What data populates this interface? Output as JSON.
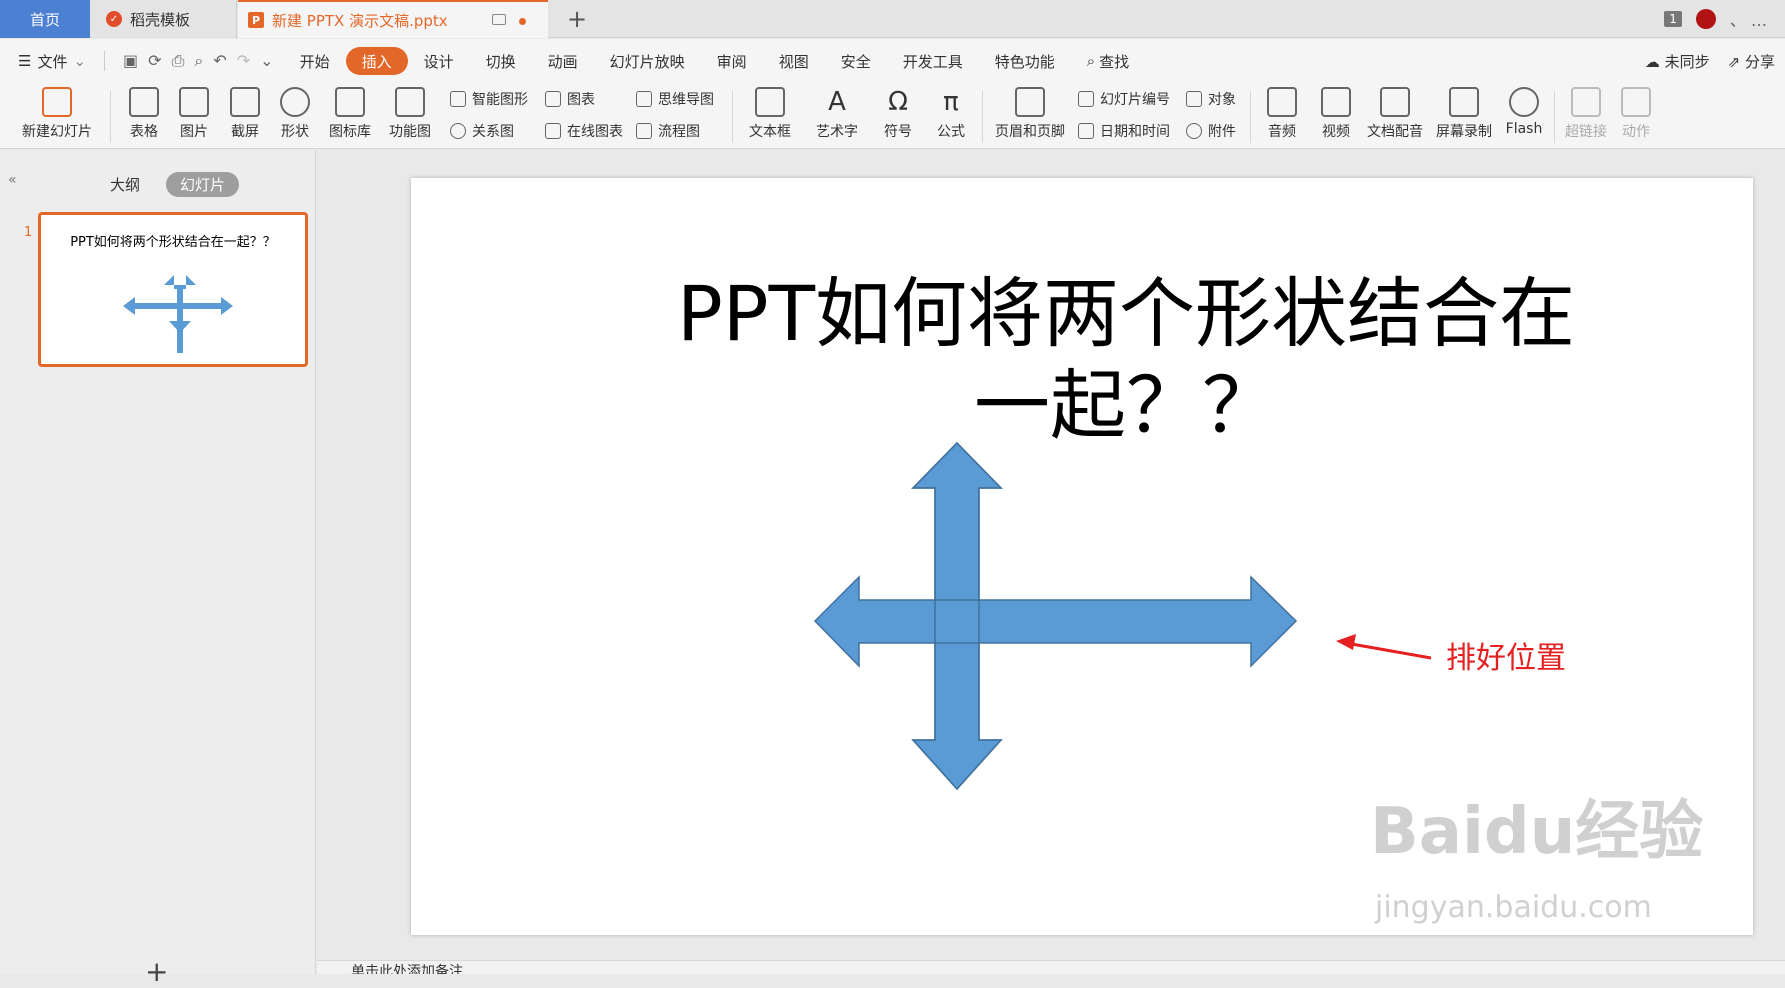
{
  "tabs": {
    "home": "首页",
    "template": "稻壳模板",
    "document": "新建 PPTX 演示文稿.pptx",
    "window_count": "1"
  },
  "menu": {
    "file": "文件",
    "items": [
      "开始",
      "插入",
      "设计",
      "切换",
      "动画",
      "幻灯片放映",
      "审阅",
      "视图",
      "安全",
      "开发工具",
      "特色功能"
    ],
    "active": "插入",
    "search": "查找",
    "sync": "未同步",
    "share": "分享"
  },
  "ribbon": {
    "new_slide": "新建幻灯片",
    "table": "表格",
    "picture": "图片",
    "screenshot": "截屏",
    "shape": "形状",
    "icon_lib": "图标库",
    "func_chart": "功能图",
    "smart_shape": "智能图形",
    "chart": "图表",
    "relation": "关系图",
    "online_chart": "在线图表",
    "mindmap": "思维导图",
    "flowchart": "流程图",
    "textbox": "文本框",
    "wordart": "艺术字",
    "symbol": "符号",
    "formula": "公式",
    "header_footer": "页眉和页脚",
    "slide_number": "幻灯片编号",
    "object": "对象",
    "date_time": "日期和时间",
    "attachment": "附件",
    "audio": "音频",
    "video": "视频",
    "doc_voice": "文档配音",
    "screen_rec": "屏幕录制",
    "flash": "Flash",
    "hyperlink": "超链接",
    "action": "动作"
  },
  "left_panel": {
    "outline": "大纲",
    "slides": "幻灯片",
    "slide_number": "1",
    "thumb_title": "PPT如何将两个形状结合在一起？？"
  },
  "slide": {
    "title_line1": "PPT如何将两个形状结合在",
    "title_line2": "一起？？",
    "annotation": "排好位置"
  },
  "notes_placeholder": "单击此处添加备注",
  "watermark": {
    "brand": "Baidu经验",
    "url": "jingyan.baidu.com"
  },
  "colors": {
    "accent": "#e4672a",
    "shape_fill": "#5b9bd5",
    "shape_stroke": "#41719c",
    "annotation": "#e62020"
  }
}
